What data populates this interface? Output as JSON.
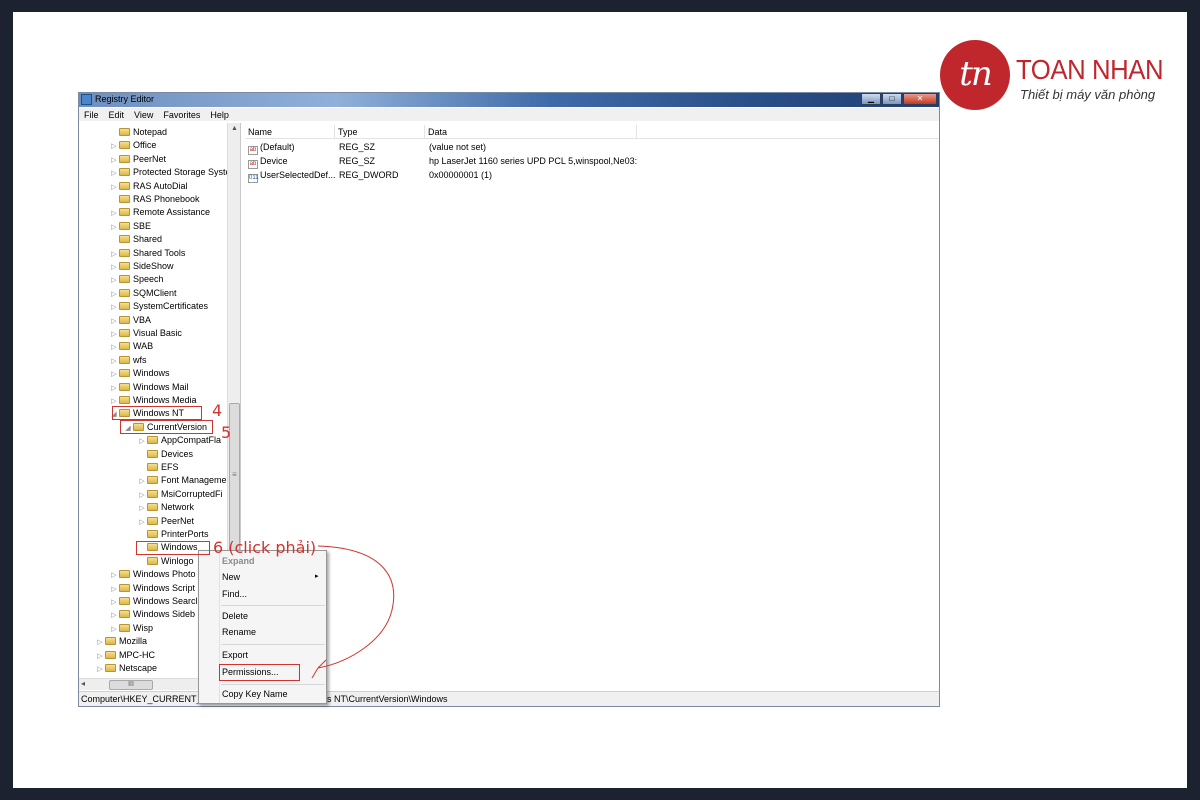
{
  "logo": {
    "mark": "tn",
    "name": "TOAN NHAN",
    "tagline": "Thiết bị máy văn phòng"
  },
  "window": {
    "title": "Registry Editor",
    "buttons": {
      "minimize": "▁",
      "maximize": "□",
      "close": "✕"
    }
  },
  "menu": [
    "File",
    "Edit",
    "View",
    "Favorites",
    "Help"
  ],
  "tree": {
    "items": [
      {
        "label": "Notepad",
        "level": 2,
        "expand": ""
      },
      {
        "label": "Office",
        "level": 2,
        "expand": "▷"
      },
      {
        "label": "PeerNet",
        "level": 2,
        "expand": "▷"
      },
      {
        "label": "Protected Storage Syste",
        "level": 2,
        "expand": "▷"
      },
      {
        "label": "RAS AutoDial",
        "level": 2,
        "expand": "▷"
      },
      {
        "label": "RAS Phonebook",
        "level": 2,
        "expand": ""
      },
      {
        "label": "Remote Assistance",
        "level": 2,
        "expand": "▷"
      },
      {
        "label": "SBE",
        "level": 2,
        "expand": "▷"
      },
      {
        "label": "Shared",
        "level": 2,
        "expand": ""
      },
      {
        "label": "Shared Tools",
        "level": 2,
        "expand": "▷"
      },
      {
        "label": "SideShow",
        "level": 2,
        "expand": "▷"
      },
      {
        "label": "Speech",
        "level": 2,
        "expand": "▷"
      },
      {
        "label": "SQMClient",
        "level": 2,
        "expand": "▷"
      },
      {
        "label": "SystemCertificates",
        "level": 2,
        "expand": "▷"
      },
      {
        "label": "VBA",
        "level": 2,
        "expand": "▷"
      },
      {
        "label": "Visual Basic",
        "level": 2,
        "expand": "▷"
      },
      {
        "label": "WAB",
        "level": 2,
        "expand": "▷"
      },
      {
        "label": "wfs",
        "level": 2,
        "expand": "▷"
      },
      {
        "label": "Windows",
        "level": 2,
        "expand": "▷"
      },
      {
        "label": "Windows Mail",
        "level": 2,
        "expand": "▷"
      },
      {
        "label": "Windows Media",
        "level": 2,
        "expand": "▷"
      },
      {
        "label": "Windows NT",
        "level": 2,
        "expand": "◢"
      },
      {
        "label": "CurrentVersion",
        "level": 3,
        "expand": "◢"
      },
      {
        "label": "AppCompatFla",
        "level": 4,
        "expand": "▷"
      },
      {
        "label": "Devices",
        "level": 4,
        "expand": ""
      },
      {
        "label": "EFS",
        "level": 4,
        "expand": ""
      },
      {
        "label": "Font Manageme",
        "level": 4,
        "expand": "▷"
      },
      {
        "label": "MsiCorruptedFi",
        "level": 4,
        "expand": "▷"
      },
      {
        "label": "Network",
        "level": 4,
        "expand": "▷"
      },
      {
        "label": "PeerNet",
        "level": 4,
        "expand": "▷"
      },
      {
        "label": "PrinterPorts",
        "level": 4,
        "expand": ""
      },
      {
        "label": "Windows",
        "level": 4,
        "expand": ""
      },
      {
        "label": "Winlogo",
        "level": 4,
        "expand": ""
      },
      {
        "label": "Windows Photo",
        "level": 2,
        "expand": "▷"
      },
      {
        "label": "Windows Script",
        "level": 2,
        "expand": "▷"
      },
      {
        "label": "Windows Searcl",
        "level": 2,
        "expand": "▷"
      },
      {
        "label": "Windows Sideb",
        "level": 2,
        "expand": "▷"
      },
      {
        "label": "Wisp",
        "level": 2,
        "expand": "▷"
      },
      {
        "label": "Mozilla",
        "level": 1,
        "expand": "▷"
      },
      {
        "label": "MPC-HC",
        "level": 1,
        "expand": "▷"
      },
      {
        "label": "Netscape",
        "level": 1,
        "expand": "▷"
      }
    ],
    "scroll_up": "▲",
    "scroll_down": "▼",
    "scroll_left": "◂",
    "scroll_right": "▸",
    "vthumb_grip": "≡",
    "hthumb_grip": "III"
  },
  "list": {
    "columns": [
      "Name",
      "Type",
      "Data"
    ],
    "rows": [
      {
        "icon": "ab",
        "name": "(Default)",
        "type": "REG_SZ",
        "data": "(value not set)"
      },
      {
        "icon": "ab",
        "name": "Device",
        "type": "REG_SZ",
        "data": "hp LaserJet 1160 series UPD PCL 5,winspool,Ne03:"
      },
      {
        "icon": "011",
        "name": "UserSelectedDef...",
        "type": "REG_DWORD",
        "data": "0x00000001 (1)"
      }
    ]
  },
  "statusbar": {
    "path_start": "Computer\\HKEY_CURRENT_U",
    "path_end": "s NT\\CurrentVersion\\Windows"
  },
  "context_menu": {
    "items": [
      "Expand",
      "New",
      "Find...",
      "Delete",
      "Rename",
      "Export",
      "Permissions...",
      "Copy Key Name"
    ],
    "submenu_arrow": "▸"
  },
  "annotations": {
    "step4": "4",
    "step5": "5",
    "step6": "6 (click phải)"
  },
  "colors": {
    "annotation": "#d1342f",
    "brand": "#c0272d"
  }
}
